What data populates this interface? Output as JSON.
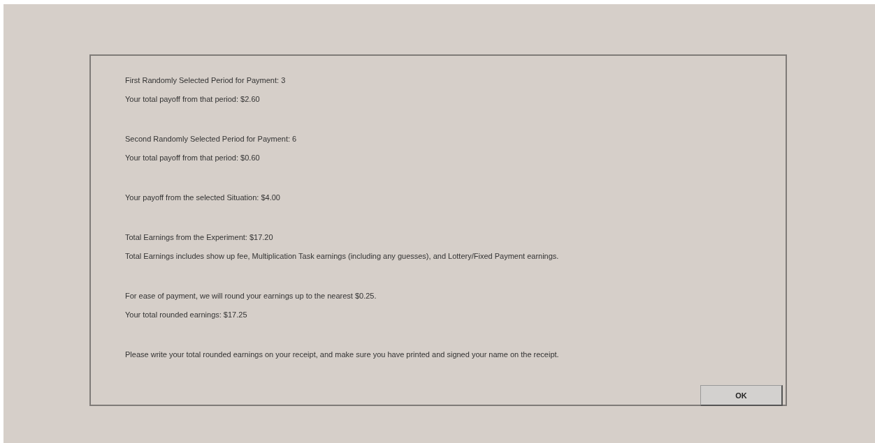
{
  "dialog": {
    "sections": [
      {
        "lines": [
          "First Randomly Selected Period for Payment: 3",
          "Your total payoff from that period: $2.60"
        ]
      },
      {
        "lines": [
          "Second Randomly Selected Period for Payment: 6",
          "Your total payoff from that period: $0.60"
        ]
      },
      {
        "lines": [
          "Your payoff from the selected Situation: $4.00"
        ]
      },
      {
        "lines": [
          "Total Earnings from the Experiment: $17.20",
          "Total Earnings includes show up fee, Multiplication Task earnings (including any guesses), and Lottery/Fixed Payment earnings."
        ]
      },
      {
        "lines": [
          "For ease of payment, we will round your earnings up to the nearest $0.25.",
          "Your total rounded earnings: $17.25"
        ]
      },
      {
        "lines": [
          "Please write your total rounded earnings on your receipt, and make sure you have printed and signed your name on the receipt."
        ]
      }
    ],
    "button": "OK"
  }
}
